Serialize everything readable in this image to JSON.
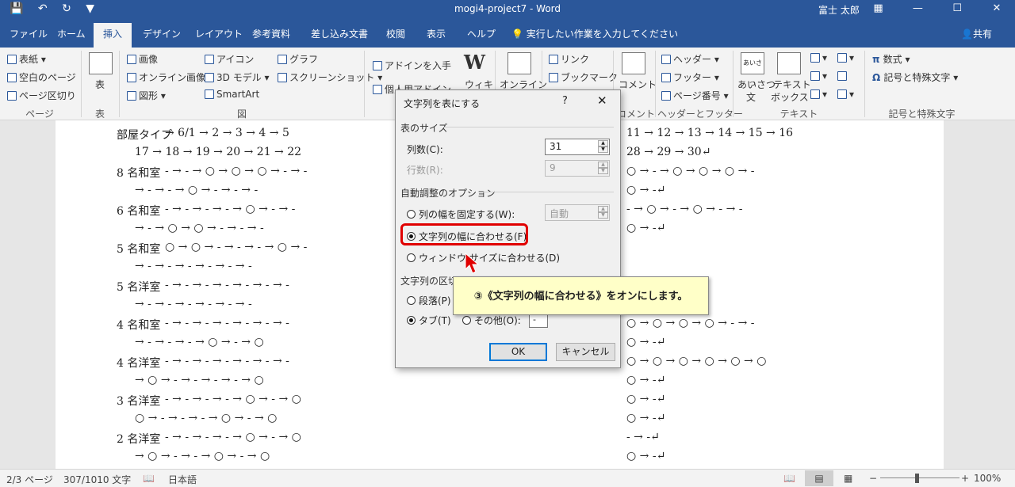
{
  "title_bar": {
    "title": "mogi4-project7 - Word",
    "user": "富士 太郎",
    "qat_icons": [
      "save-icon",
      "undo-icon",
      "redo-icon",
      "customize-icon"
    ],
    "window_icons": [
      "ribbon-display-icon",
      "minimize-icon",
      "maximize-icon",
      "close-icon"
    ]
  },
  "tabs": [
    "ファイル",
    "ホーム",
    "挿入",
    "デザイン",
    "レイアウト",
    "参考資料",
    "差し込み文書",
    "校閲",
    "表示",
    "ヘルプ"
  ],
  "active_tab": "挿入",
  "tell_me": "実行したい作業を入力してください",
  "share": "共有",
  "ribbon": {
    "pages": {
      "cover": "表紙",
      "blank": "空白のページ",
      "break": "ページ区切り",
      "label": "ページ"
    },
    "table": {
      "button": "表",
      "label": "表"
    },
    "illustrations": {
      "picture": "画像",
      "online_picture": "オンライン画像",
      "shapes": "図形",
      "icons": "アイコン",
      "model3d": "3D モデル",
      "smartart": "SmartArt",
      "chart": "グラフ",
      "screenshot": "スクリーンショット",
      "label": "図"
    },
    "addins": {
      "get": "アドインを入手",
      "my": "個人用アドイン",
      "wiki": "ウィキ"
    },
    "media": {
      "online_video": "オンライン"
    },
    "links": {
      "link": "リンク",
      "bookmark": "ブックマーク"
    },
    "comments": {
      "comment": "コメント",
      "label": "コメント"
    },
    "header_footer": {
      "header": "ヘッダー",
      "footer": "フッター",
      "page_number": "ページ番号",
      "label": "ヘッダーとフッター"
    },
    "text": {
      "greeting": "あいさつ",
      "greeting2": "文",
      "textbox": "テキスト",
      "textbox2": "ボックス",
      "label": "テキスト"
    },
    "symbols": {
      "equation": "数式",
      "symbol": "記号と特殊文字",
      "label": "記号と特殊文字"
    }
  },
  "document_lines": [
    {
      "label": "部屋タイプ",
      "seq": "→ 6/1 → 2 → 3 → 4 → 5"
    },
    {
      "label": "",
      "seq": "17 → 18 → 19 → 20 → 21 → 22"
    },
    {
      "label": "8 名和室",
      "seq": "- → - → ○ → ○ → ○ → - → -"
    },
    {
      "label": "",
      "seq": "→ - → - → ○ → - → - → -"
    },
    {
      "label": "6 名和室",
      "seq": "- → - → - → - → ○ → - → -"
    },
    {
      "label": "",
      "seq": "→ - → ○ → ○ → - → - → -"
    },
    {
      "label": "5 名和室",
      "seq": "○ → ○ → - → - → - → ○ → -"
    },
    {
      "label": "",
      "seq": "→ - → - → - → - → - → -"
    },
    {
      "label": "5 名洋室",
      "seq": "- → - → - → - → - → - → -"
    },
    {
      "label": "",
      "seq": "→ - → - → - → - → - → -"
    },
    {
      "label": "4 名和室",
      "seq": "- → - → - → - → - → - → -"
    },
    {
      "label": "",
      "seq": "→ - → - → - → ○ → - → ○"
    },
    {
      "label": "4 名洋室",
      "seq": "- → - → - → - → - → - → -"
    },
    {
      "label": "",
      "seq": "→ ○ → - → - → - → - → ○"
    },
    {
      "label": "3 名洋室",
      "seq": "- → - → - → - → ○ → - → ○"
    },
    {
      "label": "",
      "seq": "○ → - → - → - → ○ → - → ○"
    },
    {
      "label": "2 名洋室",
      "seq": "- → - → - → - → ○ → - → ○"
    },
    {
      "label": "",
      "seq": "→ ○ → - → - → ○ → - → ○"
    }
  ],
  "right_lines": [
    {
      "seq": "11 → 12 → 13 → 14 → 15 → 16"
    },
    {
      "seq": "28 → 29 → 30↵"
    },
    {
      "seq": "○ → - → ○ → ○ → ○ → -"
    },
    {
      "seq": "○ → -↵"
    },
    {
      "seq": "- → ○ → - → ○ → - → -"
    },
    {
      "seq": "○ → -↵"
    },
    {
      "seq": ""
    },
    {
      "seq": ""
    },
    {
      "seq": ""
    },
    {
      "seq": ""
    },
    {
      "seq": "○ → ○ → ○ → ○ → - → -"
    },
    {
      "seq": "○ → -↵"
    },
    {
      "seq": "○ → ○ → ○ → ○ → ○ → ○"
    },
    {
      "seq": "○ → -↵"
    },
    {
      "seq": "○ → -↵"
    },
    {
      "seq": "○ → -↵"
    },
    {
      "seq": "- → -↵"
    },
    {
      "seq": "○ → -↵"
    }
  ],
  "dialog": {
    "title": "文字列を表にする",
    "help": "?",
    "close": "✕",
    "table_size": "表のサイズ",
    "columns_label": "列数(C):",
    "columns_value": "31",
    "rows_label": "行数(R):",
    "rows_value": "9",
    "autofit": "自動調整のオプション",
    "fixed_width": "列の幅を固定する(W):",
    "fixed_width_value": "自動",
    "autofit_contents": "文字列の幅に合わせる(F)",
    "autofit_window": "ウィンドウ サイズに合わせる(D)",
    "separator": "文字列の区切り",
    "paragraph": "段落(P)",
    "tab": "タブ(T)",
    "other": "その他(O):",
    "other_value": "-",
    "ok": "OK",
    "cancel": "キャンセル"
  },
  "callout": "③《文字列の幅に合わせる》をオンにします。",
  "status_bar": {
    "page": "2/3 ページ",
    "words": "307/1010 文字",
    "language": "日本語",
    "zoom": "100%"
  },
  "colors": {
    "accent": "#2b579a",
    "highlight": "#e00000",
    "callout": "#ffffc8"
  }
}
